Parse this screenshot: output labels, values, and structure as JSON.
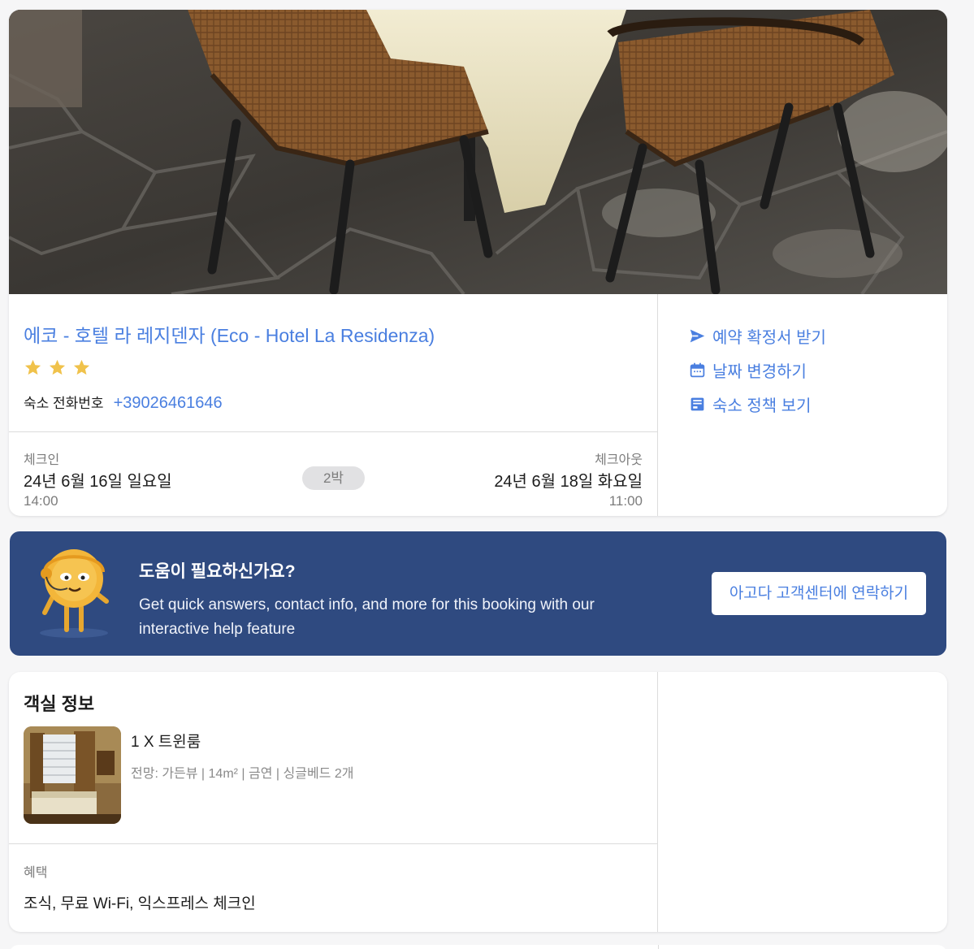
{
  "hotel": {
    "name": "에코 - 호텔 라 레지덴자 (Eco - Hotel La Residenza)",
    "star_rating": 3,
    "phone_label": "숙소 전화번호",
    "phone_number": "+39026461646",
    "hero_image": "restaurant-patio-chairs-photo"
  },
  "stay": {
    "checkin_label": "체크인",
    "checkin_date": "24년 6월 16일 일요일",
    "checkin_time": "14:00",
    "nights": "2박",
    "checkout_label": "체크아웃",
    "checkout_date": "24년 6월 18일 화요일",
    "checkout_time": "11:00"
  },
  "actions": [
    {
      "label": "예약 확정서 받기",
      "icon": "send-icon"
    },
    {
      "label": "날짜 변경하기",
      "icon": "calendar-icon"
    },
    {
      "label": "숙소 정책 보기",
      "icon": "pdf-icon"
    }
  ],
  "help": {
    "title": "도움이 필요하신가요?",
    "description": "Get quick answers, contact info, and more for this booking with our interactive help feature",
    "button_label": "아고다 고객센터에 연락하기",
    "mascot": "agoda-mascot-icon"
  },
  "room": {
    "section_title": "객실 정보",
    "type": "1 X 트윈룸",
    "details": "전망: 가든뷰 | 14m² | 금연 | 싱글베드 2개",
    "thumbnail": "twin-room-photo",
    "benefits_label": "혜택",
    "benefits": "조식, 무료 Wi-Fi, 익스프레스 체크인"
  },
  "colors": {
    "accent": "#4a7fe0",
    "banner": "#2f4a80",
    "star": "#f0c24b",
    "muted": "#7c7c7c"
  }
}
